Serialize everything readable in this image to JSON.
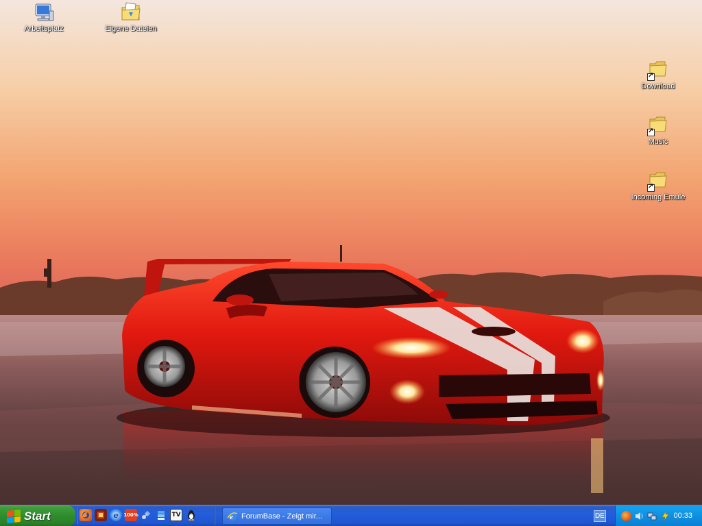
{
  "desktop": {
    "icons": [
      {
        "label": "Arbeitsplatz",
        "icon": "my-computer-icon"
      },
      {
        "label": "Eigene Dateien",
        "icon": "my-documents-icon"
      },
      {
        "label": "Download",
        "icon": "folder-shortcut-icon"
      },
      {
        "label": "Music",
        "icon": "folder-shortcut-icon"
      },
      {
        "label": "Incoming Emule",
        "icon": "folder-shortcut-icon"
      }
    ]
  },
  "taskbar": {
    "start_label": "Start",
    "quick_launch": [
      {
        "icon": "firefox-icon"
      },
      {
        "icon": "game-icon"
      },
      {
        "icon": "ie-icon"
      },
      {
        "icon": "percent-app-icon",
        "text": "100%"
      },
      {
        "icon": "satellite-icon"
      },
      {
        "icon": "stack-app-icon"
      },
      {
        "icon": "tv-icon",
        "text": "TV"
      },
      {
        "icon": "penguin-icon"
      }
    ],
    "tasks": [
      {
        "label": "ForumBase - Zeigt mir...",
        "icon": "ie-icon"
      }
    ],
    "language": "DE",
    "tray_icons": [
      "firefox-tray-icon",
      "audio-tray-icon",
      "network-tray-icon",
      "power-tray-icon"
    ],
    "clock": "00:33"
  },
  "colors": {
    "taskbar_blue": "#245edb",
    "start_green": "#3c9a3a",
    "tray_blue": "#0f8fe0"
  }
}
